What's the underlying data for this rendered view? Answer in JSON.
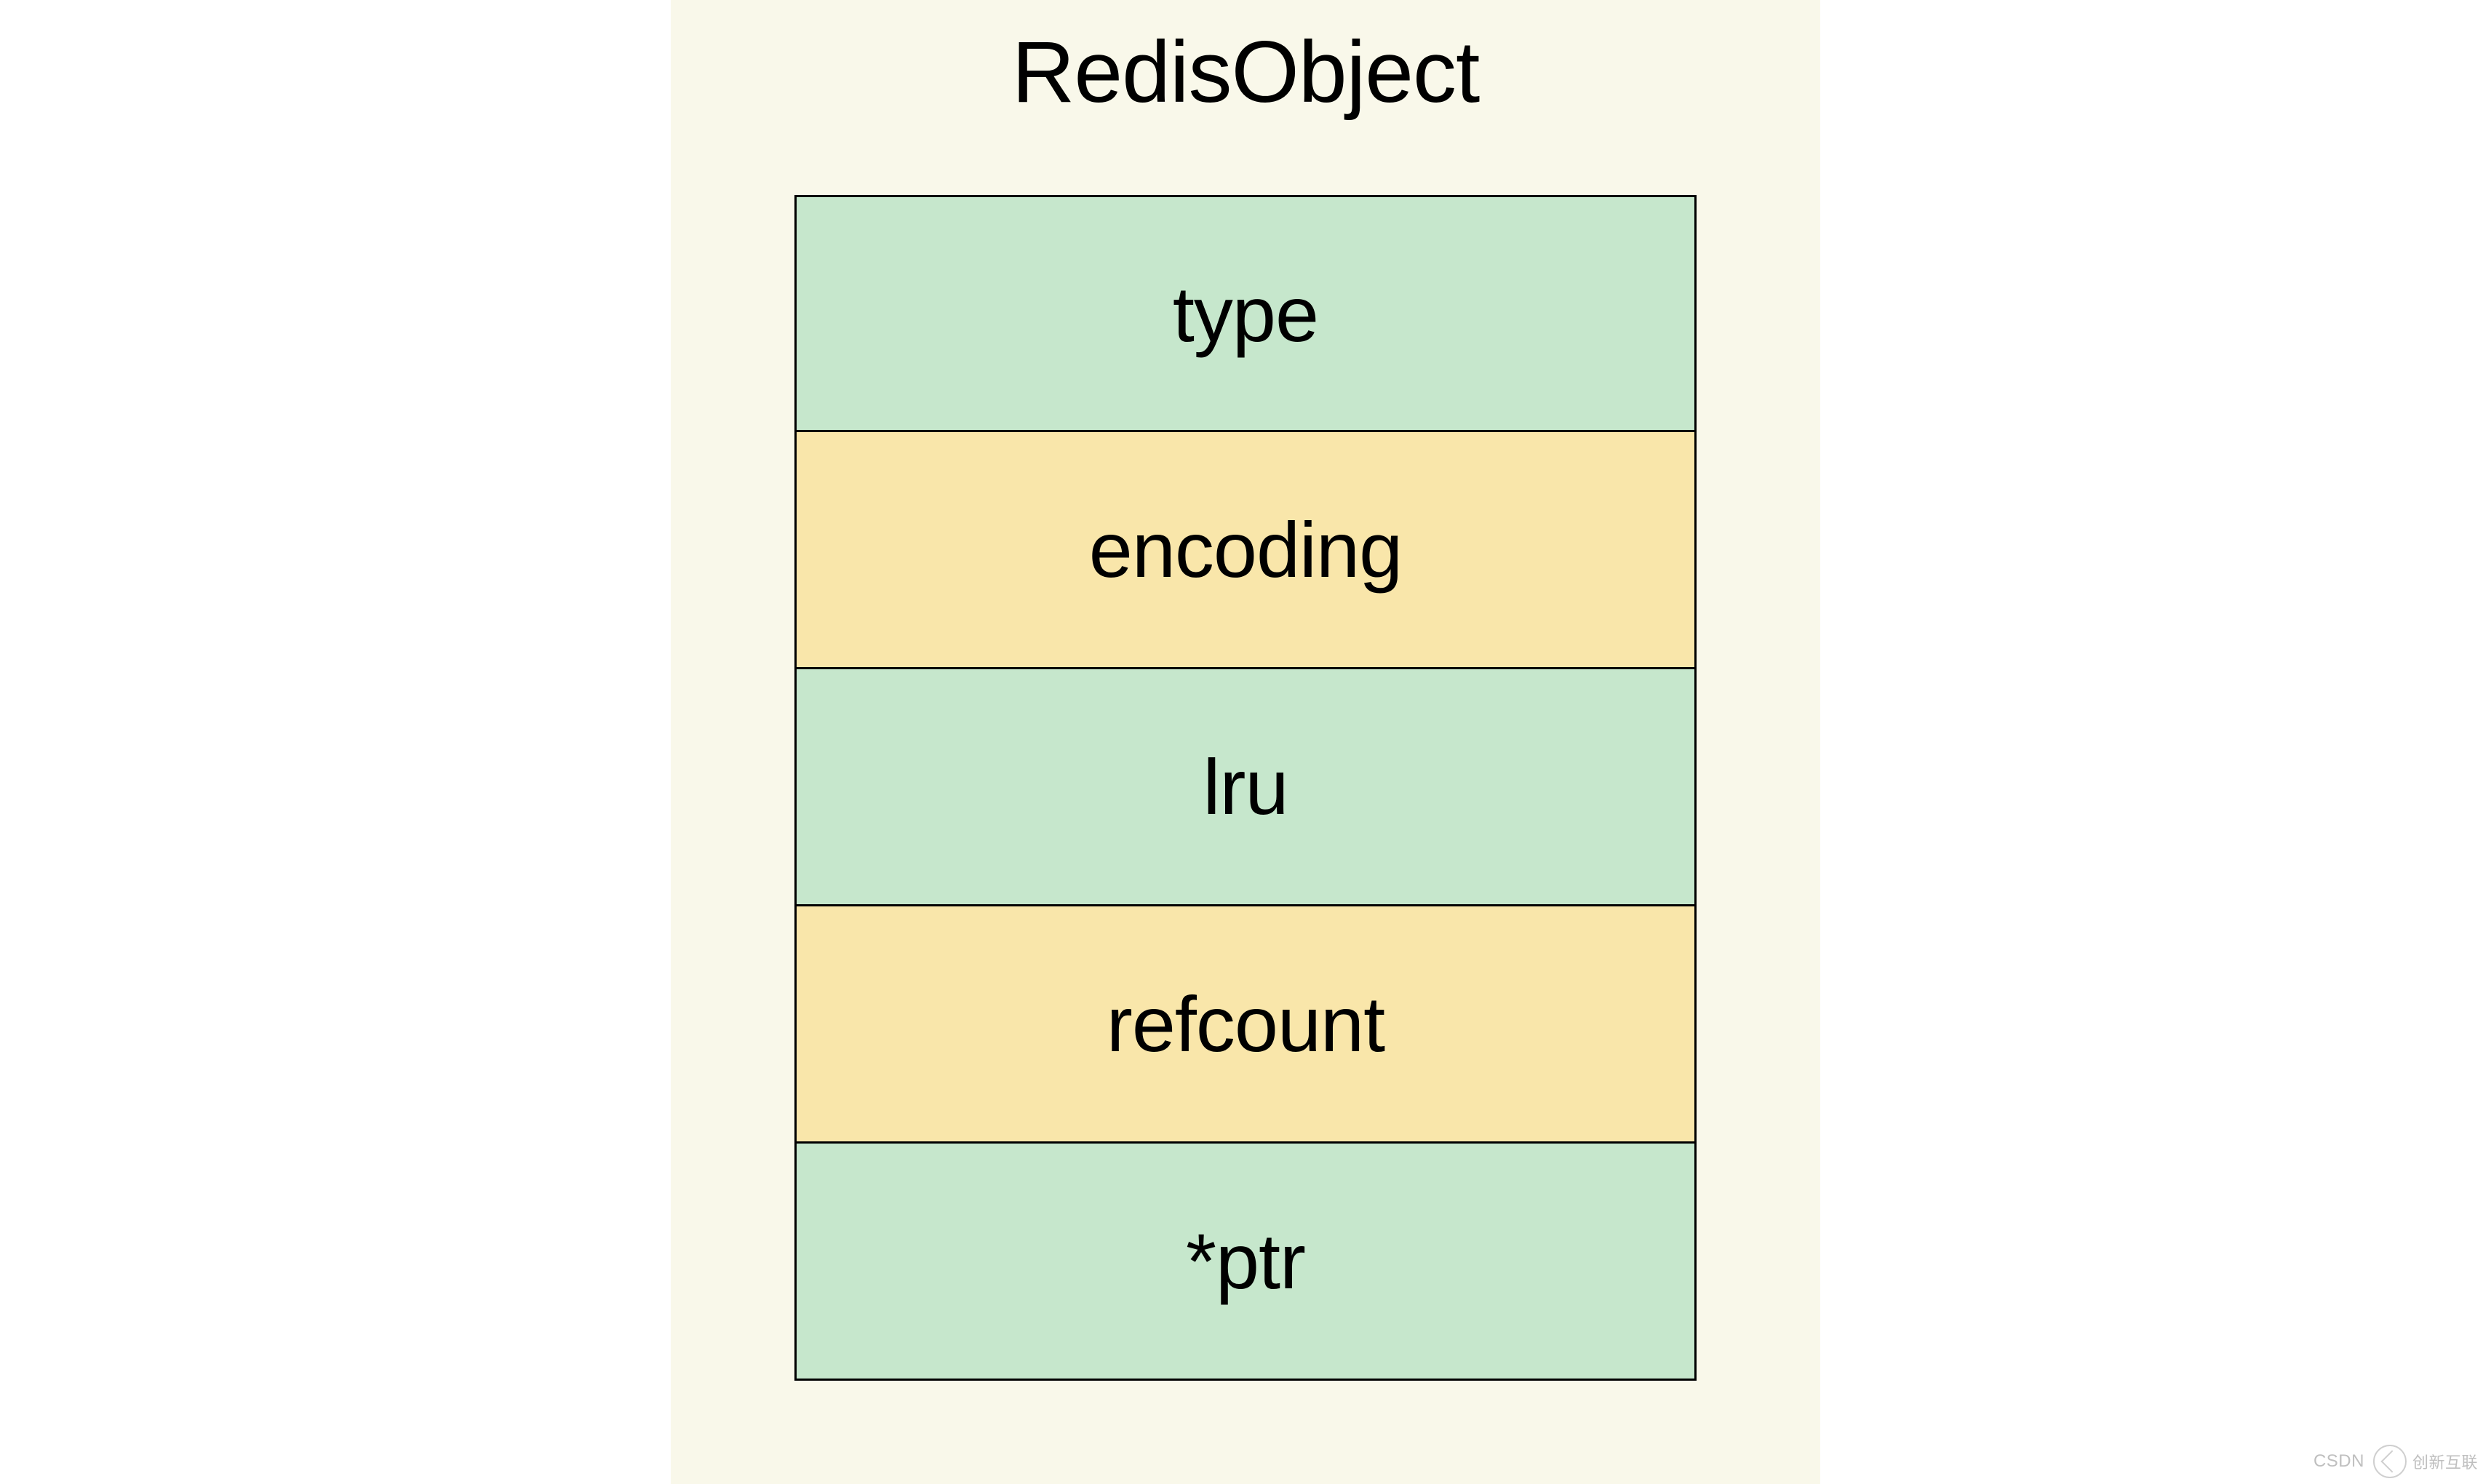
{
  "diagram": {
    "title": "RedisObject",
    "fields": [
      {
        "label": "type",
        "color": "green"
      },
      {
        "label": "encoding",
        "color": "yellow"
      },
      {
        "label": "lru",
        "color": "green"
      },
      {
        "label": "refcount",
        "color": "yellow"
      },
      {
        "label": "*ptr",
        "color": "green"
      }
    ]
  },
  "watermark": {
    "csdn": "CSDN",
    "brand": "创新互联"
  },
  "colors": {
    "green": "#c6e7cc",
    "yellow": "#f9e6aa",
    "background": "#f9f8ea"
  }
}
